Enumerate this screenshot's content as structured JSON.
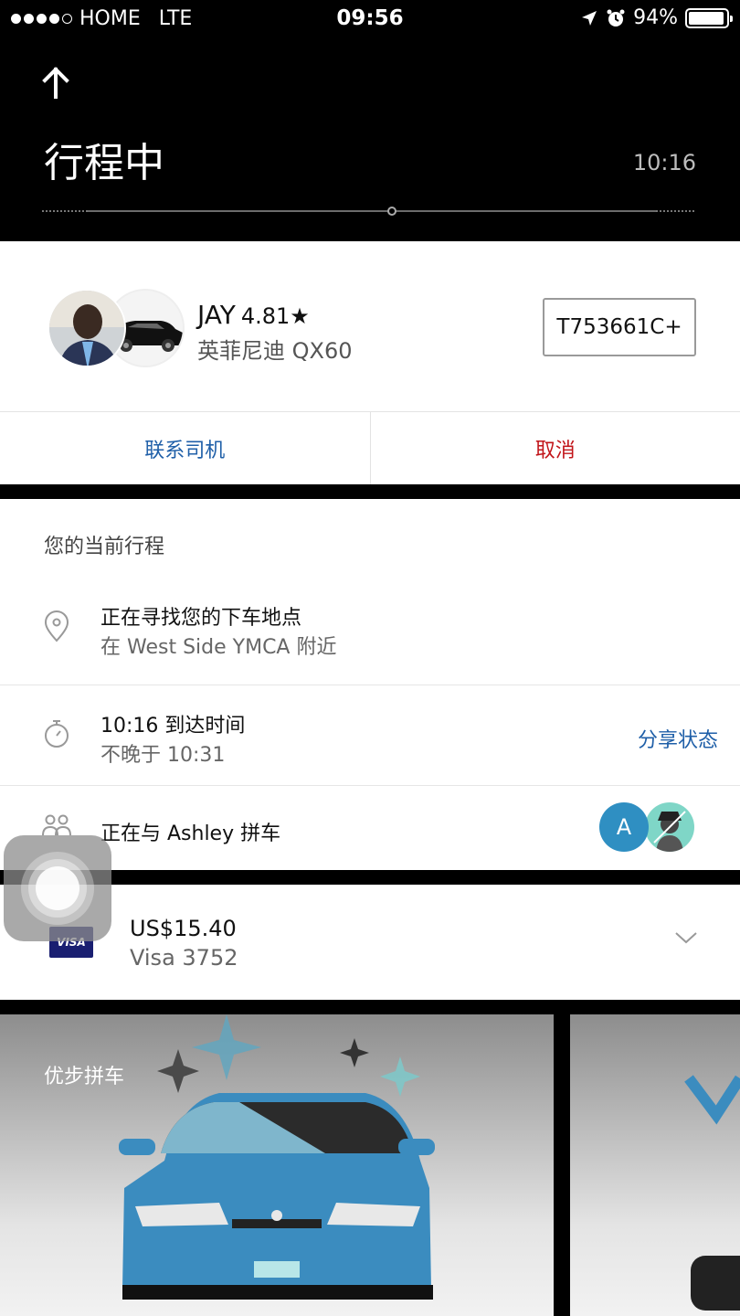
{
  "status_bar": {
    "carrier": "HOME",
    "network": "LTE",
    "time": "09:56",
    "battery": "94%",
    "battery_level": 0.94
  },
  "header": {
    "title": "行程中",
    "eta": "10:16"
  },
  "driver": {
    "name": "JAY",
    "rating": "4.81★",
    "car": "英菲尼迪 QX60",
    "plate": "T753661C+"
  },
  "actions": {
    "contact": "联系司机",
    "cancel": "取消"
  },
  "trip": {
    "section_title": "您的当前行程",
    "dropoff_main": "正在寻找您的下车地点",
    "dropoff_sub": "在 West Side YMCA 附近",
    "arrival_main": "10:16 到达时间",
    "arrival_sub": "不晚于 10:31",
    "share": "分享状态",
    "pool_text": "正在与 Ashley 拼车",
    "rider_initial": "A"
  },
  "payment": {
    "card_brand": "VISA",
    "price": "US$15.40",
    "card": "Visa 3752"
  },
  "promo": {
    "label": "优步拼车"
  },
  "colors": {
    "link_blue": "#1f5fa8",
    "cancel_red": "#c2151a",
    "car_blue": "#3b8cbf"
  }
}
